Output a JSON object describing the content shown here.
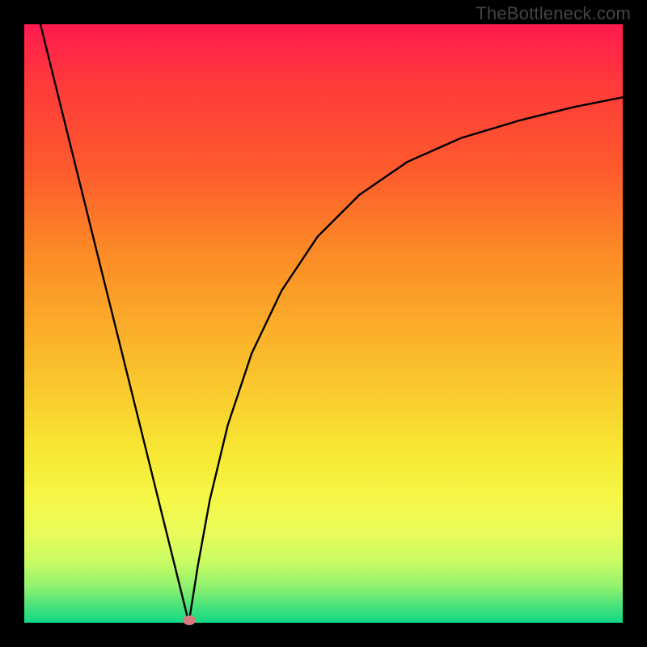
{
  "watermark": "TheBottleneck.com",
  "chart_data": {
    "type": "line",
    "title": "",
    "xlabel": "",
    "ylabel": "",
    "xlim": [
      0,
      1
    ],
    "ylim": [
      0,
      1
    ],
    "grid": false,
    "legend": false,
    "background_gradient": {
      "top": "#ff1a4f",
      "middle": "#f9d22f",
      "bottom": "#10d986"
    },
    "series": [
      {
        "name": "left-branch",
        "x": [
          0.027,
          0.06,
          0.093,
          0.126,
          0.159,
          0.192,
          0.225,
          0.258,
          0.275
        ],
        "y": [
          1.0,
          0.867,
          0.734,
          0.601,
          0.468,
          0.335,
          0.202,
          0.069,
          0.0
        ]
      },
      {
        "name": "right-branch",
        "x": [
          0.275,
          0.29,
          0.31,
          0.34,
          0.38,
          0.43,
          0.49,
          0.56,
          0.64,
          0.73,
          0.83,
          0.92,
          1.0
        ],
        "y": [
          0.0,
          0.095,
          0.205,
          0.33,
          0.45,
          0.555,
          0.645,
          0.715,
          0.77,
          0.81,
          0.84,
          0.862,
          0.878
        ]
      }
    ],
    "markers": [
      {
        "name": "dip-marker",
        "x": 0.275,
        "y": 0.004,
        "color": "#d77a7b"
      }
    ]
  },
  "colors": {
    "frame": "#000000",
    "curve": "#000000",
    "marker": "#d77a7b",
    "watermark": "#444444"
  }
}
